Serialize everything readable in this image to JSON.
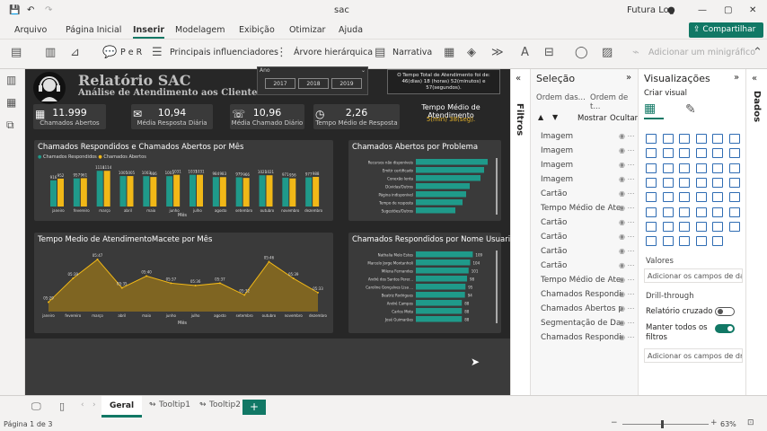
{
  "titlebar": {
    "title": "sac",
    "user": "Futura Log"
  },
  "menu": [
    "Arquivo",
    "Página Inicial",
    "Inserir",
    "Modelagem",
    "Exibição",
    "Otimizar",
    "Ajuda"
  ],
  "share": "Compartilhar",
  "ribbon": {
    "qa": "P e R",
    "key": "Principais influenciadores",
    "tree": "Árvore hierárquica",
    "narr": "Narrativa",
    "smart": "Adicionar um minigráfico"
  },
  "report": {
    "title": "Relatório SAC",
    "subtitle": "Análise de Atendimento aos Clientes",
    "year_label": "Ano",
    "years": [
      "2017",
      "2018",
      "2019"
    ],
    "note": "O Tempo Total de Atendimento foi de: 46(dias) 18 (horas) 52(minutos) e 57(segundos).",
    "kpis": [
      {
        "value": "11.999",
        "label": "Chamados Abertos"
      },
      {
        "value": "10,94",
        "label": "Média Resposta Diária"
      },
      {
        "value": "10,96",
        "label": "Média Chamado Diário"
      },
      {
        "value": "2,26",
        "label": "Tempo Médio de Resposta"
      }
    ],
    "tma_title": "Tempo Médio de Atendimento",
    "tma_value": "5(min) 38(seg).",
    "bar_title": "Chamados Respondidos e Chamados Abertos por Mês",
    "line_title": "Tempo Medio de AtendimentoMacete por Mês",
    "prob_title": "Chamados Abertos por Problema",
    "user_title": "Chamados Respondidos por Nome Usuario",
    "xlabel": "Mês"
  },
  "chart_data": [
    {
      "type": "bar",
      "title": "Chamados Respondidos e Chamados Abertos por Mês",
      "xlabel": "Mês",
      "categories": [
        "janeiro",
        "fevereiro",
        "março",
        "abril",
        "maio",
        "junho",
        "julho",
        "agosto",
        "setembro",
        "outubro",
        "novembro",
        "dezembro"
      ],
      "series": [
        {
          "name": "Chamados Respondidos",
          "values": [
            916,
            957,
            1114,
            1005,
            1003,
            1003,
            1031,
            984,
            979,
            1021,
            971,
            977
          ]
        },
        {
          "name": "Chamados Abertos",
          "values": [
            952,
            961,
            1114,
            1005,
            986,
            1031,
            1031,
            983,
            966,
            1021,
            956,
            988
          ]
        }
      ],
      "labels": [
        "916",
        "952",
        "957",
        "961",
        "1114",
        "1005",
        "1003",
        "986",
        "1003",
        "1031",
        "1031",
        "984",
        "983",
        "979",
        "966",
        "1021",
        "971",
        "956",
        "977",
        "988"
      ]
    },
    {
      "type": "area",
      "title": "Tempo Medio de AtendimentoMacete por Mês",
      "xlabel": "Mês",
      "categories": [
        "janeiro",
        "fevereiro",
        "março",
        "abril",
        "maio",
        "junho",
        "julho",
        "agosto",
        "setembro",
        "outubro",
        "novembro",
        "dezembro"
      ],
      "values_label": [
        "05:29",
        "05:39",
        "05:47",
        "05:35",
        "05:40",
        "05:37",
        "05:36",
        "05:37",
        "05:32",
        "05:46",
        "05:39",
        "05:33"
      ],
      "values": [
        29,
        39,
        47,
        35,
        40,
        37,
        36,
        37,
        32,
        46,
        39,
        33
      ]
    },
    {
      "type": "bar",
      "title": "Chamados Abertos por Problema",
      "categories": [
        "Recursos não disponíveis",
        "Emitir certificado",
        "Conexão lenta",
        "Dúvidas/Outros",
        "Página indisponível",
        "Tempo de resposta",
        "Sugestões/Outros"
      ],
      "values": [
        100,
        95,
        90,
        75,
        70,
        65,
        55
      ]
    },
    {
      "type": "bar",
      "title": "Chamados Respondidos por Nome Usuario",
      "categories": [
        "Nathalia Melo Estes",
        "Marcelo Jorge Montanholi",
        "Milena Fernandes",
        "André dos Santos Perer...",
        "Caroline Gonçalves Lisa ...",
        "Beatriz Rodrigues",
        "André Campos",
        "Carlos Mota",
        "José Guimarães"
      ],
      "values": [
        109,
        104,
        101,
        98,
        95,
        94,
        88,
        88,
        88
      ]
    }
  ],
  "filters": "Filtros",
  "selection": {
    "title": "Seleção",
    "order1": "Ordem das...",
    "order2": "Ordem de t...",
    "show": "Mostrar",
    "hide": "Ocultar",
    "items": [
      "Imagem",
      "Imagem",
      "Imagem",
      "Imagem",
      "Cartão",
      "Tempo Médio de Aten...",
      "Cartão",
      "Cartão",
      "Cartão",
      "Cartão",
      "Tempo Médio de Aten...",
      "Chamados Respondid...",
      "Chamados Abertos po...",
      "Segmentação de Dados",
      "Chamados Respondid..."
    ]
  },
  "visual": {
    "title": "Visualizações",
    "build": "Criar visual",
    "values": "Valores",
    "values_add": "Adicionar os campos de da...",
    "drill": "Drill-through",
    "cross": "Relatório cruzado",
    "keep": "Manter todos os filtros",
    "drill_add": "Adicionar os campos de dr..."
  },
  "data_rail": "Dados",
  "tabs": [
    "Geral",
    "Tooltip1",
    "Tooltip2"
  ],
  "status": {
    "page": "Página 1 de 3",
    "zoom": "63%"
  }
}
